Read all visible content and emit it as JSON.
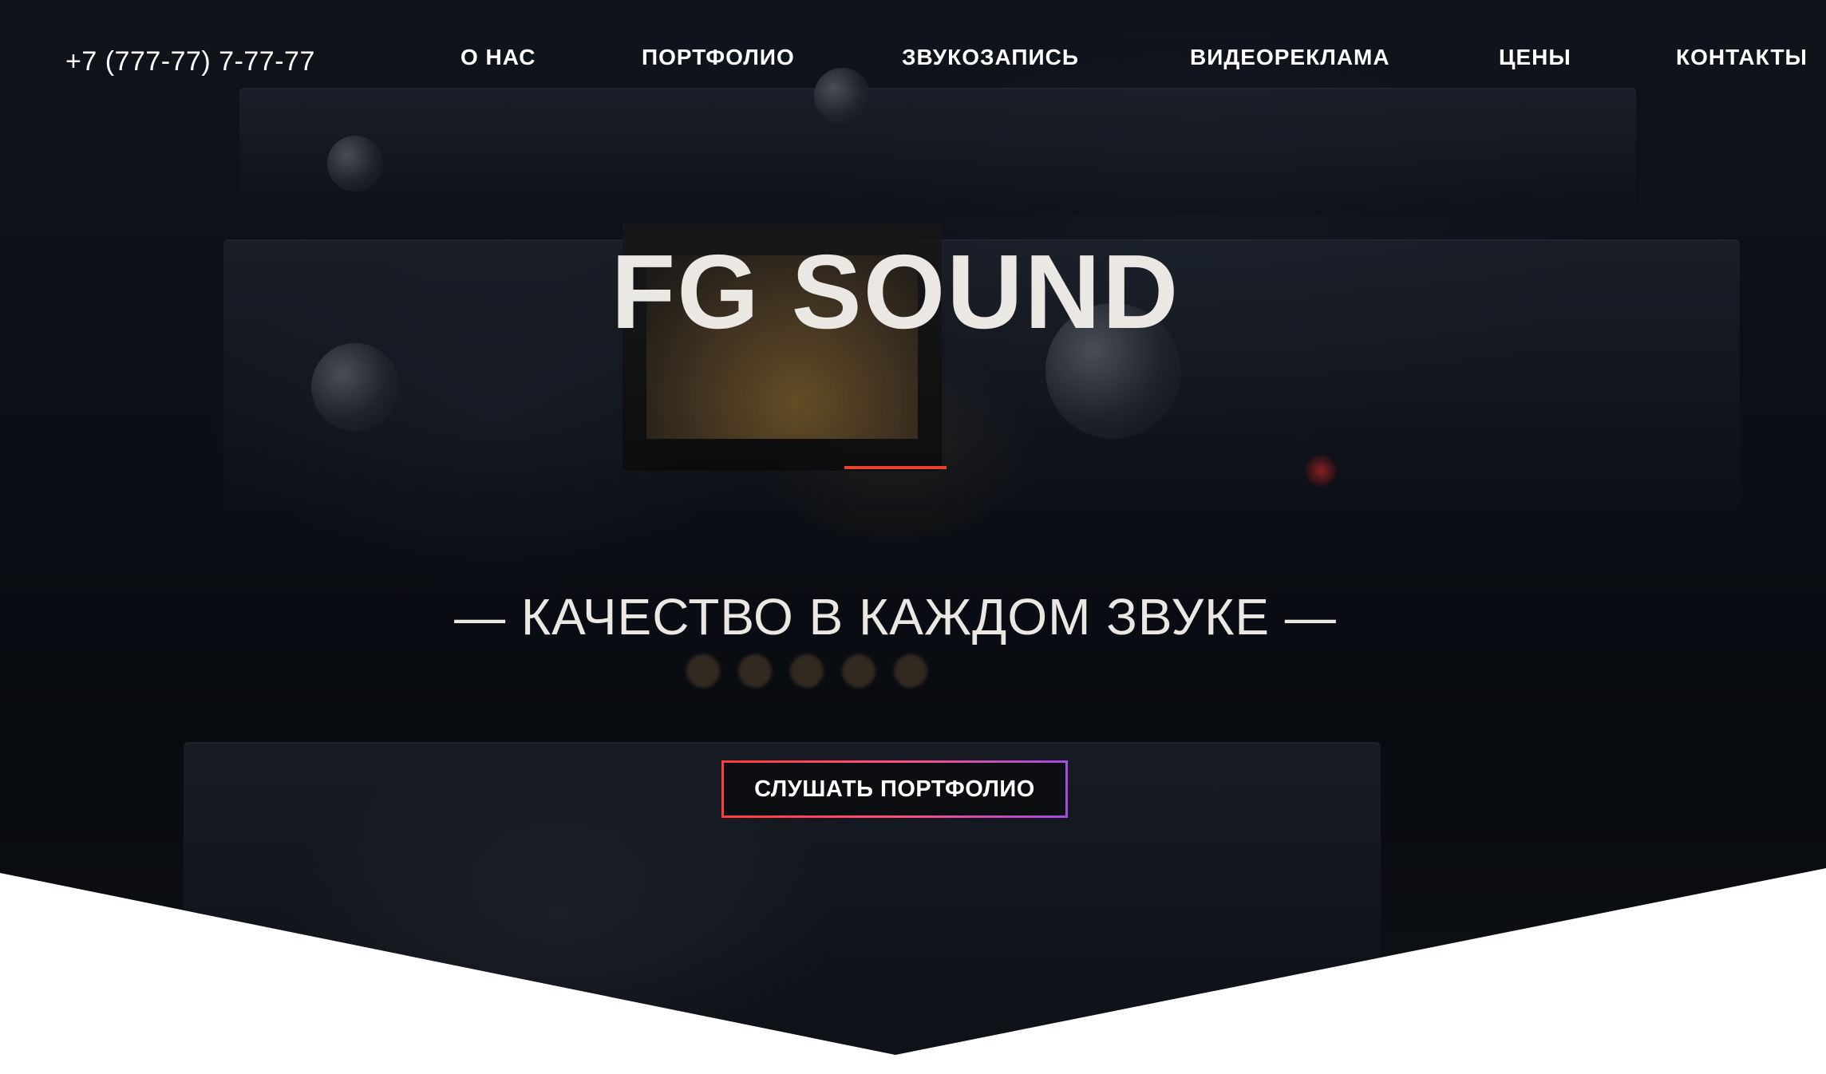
{
  "header": {
    "phone": "+7 (777-77) 7-77-77",
    "nav": [
      {
        "label": "О НАС"
      },
      {
        "label": "ПОРТФОЛИО"
      },
      {
        "label": "ЗВУКОЗАПИСЬ"
      },
      {
        "label": "ВИДЕОРЕКЛАМА"
      },
      {
        "label": "ЦЕНЫ"
      },
      {
        "label": "КОНТАКТЫ"
      }
    ]
  },
  "hero": {
    "title": "FG SOUND",
    "tagline": "— КАЧЕСТВО В КАЖДОМ ЗВУКЕ —",
    "cta_label": "СЛУШАТЬ ПОРТФОЛИО"
  },
  "colors": {
    "accent": "#e8412f",
    "cta_gradient_start": "#ff3b3b",
    "cta_gradient_end": "#a14de0",
    "text": "#ebe8e3"
  }
}
